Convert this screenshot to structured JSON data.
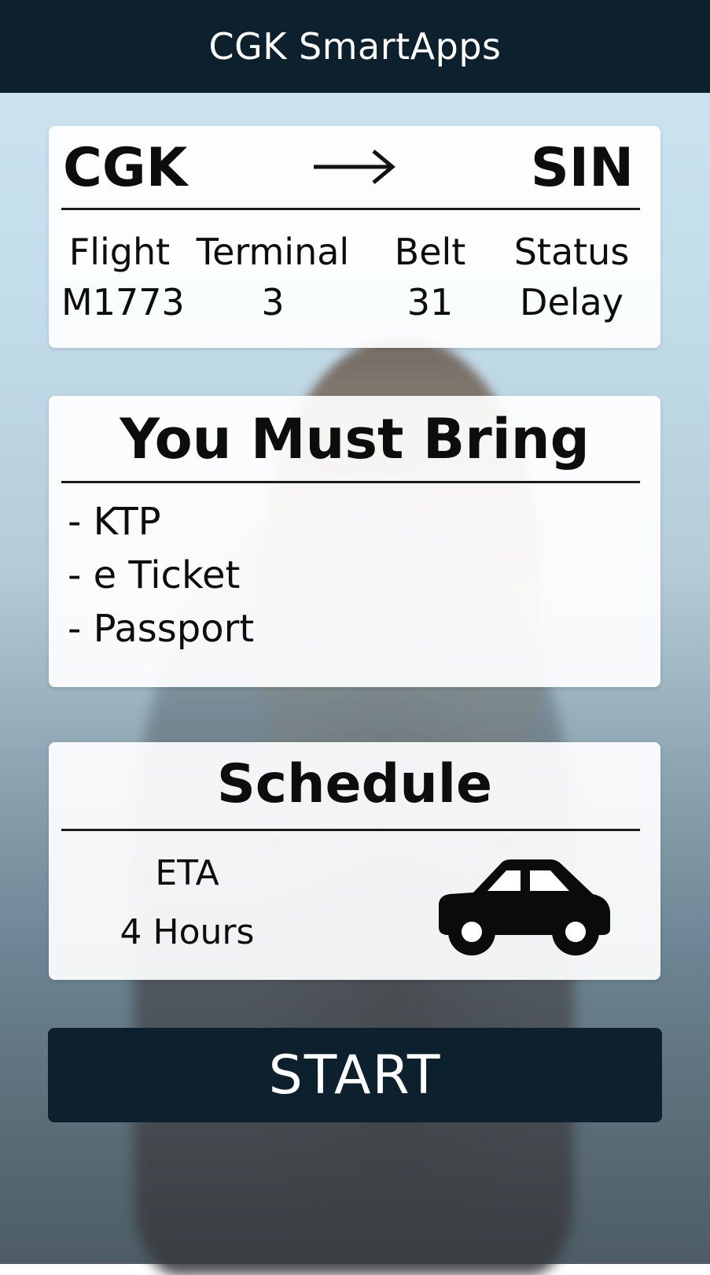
{
  "header": {
    "title": "CGK SmartApps"
  },
  "flight": {
    "origin": "CGK",
    "destination": "SIN",
    "arrow_icon": "arrow-right-icon",
    "columns": [
      {
        "label": "Flight",
        "value": "M1773"
      },
      {
        "label": "Terminal",
        "value": "3"
      },
      {
        "label": "Belt",
        "value": "31"
      },
      {
        "label": "Status",
        "value": "Delay"
      }
    ]
  },
  "bring": {
    "title": "You Must Bring",
    "items": [
      "- KTP",
      "- e Ticket",
      "- Passport"
    ]
  },
  "schedule": {
    "title": "Schedule",
    "eta_label": "ETA",
    "eta_value": "4 Hours",
    "transport_icon": "car-icon"
  },
  "start_button": {
    "label": "START"
  },
  "colors": {
    "header_bg": "#0c212d",
    "button_bg": "#0c212d",
    "card_bg": "#ffffff",
    "text": "#0d0d0d"
  }
}
